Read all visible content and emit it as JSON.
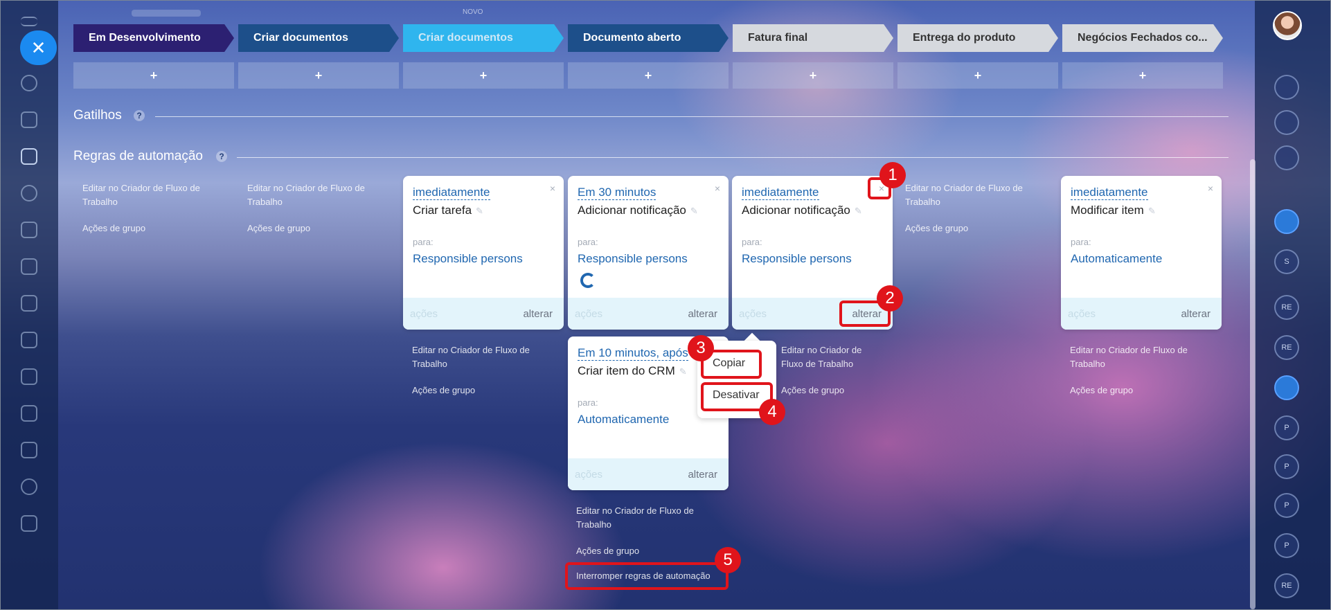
{
  "stages": [
    {
      "label": "Em Desenvolvimento",
      "color": "#2c2072"
    },
    {
      "label": "Criar documentos",
      "color": "#1d4f8a"
    },
    {
      "label": "Criar documentos",
      "color": "#2fb5ee",
      "text_color": "#cfe8f6"
    },
    {
      "label": "Documento aberto",
      "color": "#1d4f8a"
    },
    {
      "label": "Fatura final",
      "color": "#d6d9de",
      "text_color": "#333"
    },
    {
      "label": "Entrega do produto",
      "color": "#d6d9de",
      "text_color": "#333"
    },
    {
      "label": "Negócios Fechados co...",
      "color": "#d6d9de",
      "text_color": "#333"
    }
  ],
  "plus_label": "+",
  "top_label": "NOVO",
  "sections": {
    "triggers": "Gatilhos",
    "rules": "Regras de automação",
    "help": "?"
  },
  "column_links": {
    "edit": "Editar no Criador de Fluxo de Trabalho",
    "group": "Ações de grupo",
    "stop": "Interromper regras de automação"
  },
  "cards": [
    {
      "when": "imediatamente",
      "action": "Criar tarefa",
      "para": "para:",
      "target": "Responsible persons",
      "acoes": "ações",
      "alterar": "alterar"
    },
    {
      "when": "Em 30 minutos",
      "action": "Adicionar notificação",
      "para": "para:",
      "target": "Responsible persons",
      "acoes": "ações",
      "alterar": "alterar"
    },
    {
      "when": "imediatamente",
      "action": "Adicionar notificação",
      "para": "para:",
      "target": "Responsible persons",
      "acoes": "ações",
      "alterar": "alterar"
    },
    {
      "when": "imediatamente",
      "action": "Modificar item",
      "para": "para:",
      "target": "Automaticamente",
      "acoes": "ações",
      "alterar": "alterar"
    },
    {
      "when": "Em 10 minutos, após",
      "action": "Criar item do CRM",
      "para": "para:",
      "target": "Automaticamente",
      "acoes": "ações",
      "alterar": "alterar"
    }
  ],
  "context_menu": {
    "copy": "Copiar",
    "disable": "Desativar"
  },
  "callouts": [
    "1",
    "2",
    "3",
    "4",
    "5"
  ],
  "right_rail": [
    "S",
    "RE",
    "RE",
    "P",
    "P",
    "P",
    "P",
    "RE"
  ],
  "close_glyph": "✕",
  "card_close_glyph": "×",
  "pencil_glyph": "✎",
  "colors": {
    "accent": "#e0141b",
    "link": "#2067b0",
    "primary": "#1b8af0"
  }
}
